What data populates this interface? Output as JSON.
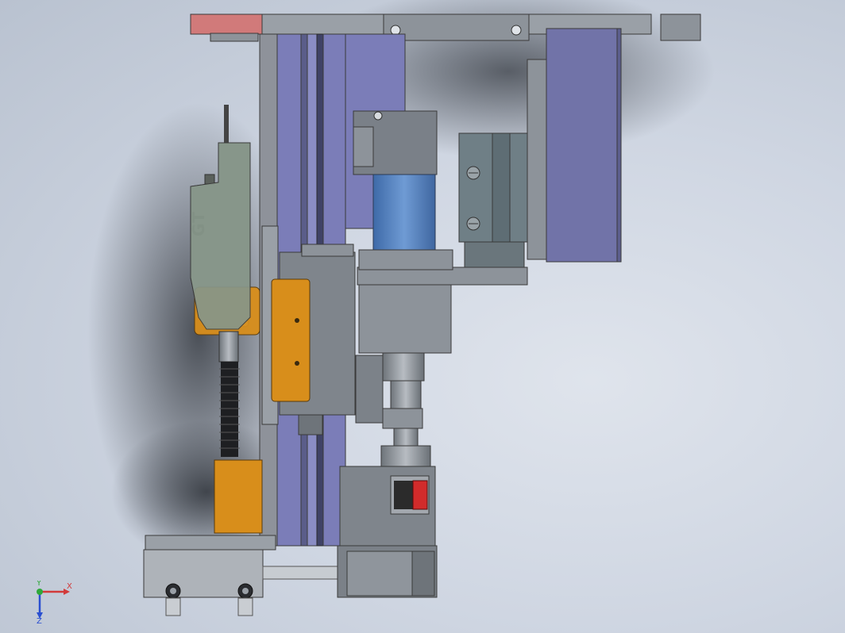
{
  "model": {
    "label_text": "GT"
  },
  "triad": {
    "x_label": "X",
    "y_label": "Y",
    "z_label": "Z",
    "x_color": "#d23a3a",
    "y_color": "#2fa83a",
    "z_color": "#2a4fd0"
  },
  "colors": {
    "plate_gray": "#8d939a",
    "rail_purple": "#7b7db8",
    "orange": "#d88e1b",
    "motor_blue": "#5b86c2",
    "sensor_red": "#d22b2b",
    "accent_pink": "#d17a7a"
  }
}
